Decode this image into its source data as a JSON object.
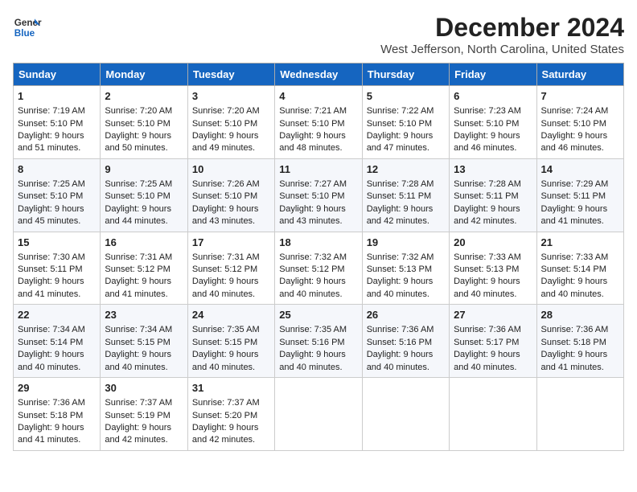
{
  "header": {
    "logo_line1": "General",
    "logo_line2": "Blue",
    "month": "December 2024",
    "location": "West Jefferson, North Carolina, United States"
  },
  "weekdays": [
    "Sunday",
    "Monday",
    "Tuesday",
    "Wednesday",
    "Thursday",
    "Friday",
    "Saturday"
  ],
  "weeks": [
    [
      {
        "day": "1",
        "sunrise": "7:19 AM",
        "sunset": "5:10 PM",
        "daylight": "9 hours and 51 minutes."
      },
      {
        "day": "2",
        "sunrise": "7:20 AM",
        "sunset": "5:10 PM",
        "daylight": "9 hours and 50 minutes."
      },
      {
        "day": "3",
        "sunrise": "7:20 AM",
        "sunset": "5:10 PM",
        "daylight": "9 hours and 49 minutes."
      },
      {
        "day": "4",
        "sunrise": "7:21 AM",
        "sunset": "5:10 PM",
        "daylight": "9 hours and 48 minutes."
      },
      {
        "day": "5",
        "sunrise": "7:22 AM",
        "sunset": "5:10 PM",
        "daylight": "9 hours and 47 minutes."
      },
      {
        "day": "6",
        "sunrise": "7:23 AM",
        "sunset": "5:10 PM",
        "daylight": "9 hours and 46 minutes."
      },
      {
        "day": "7",
        "sunrise": "7:24 AM",
        "sunset": "5:10 PM",
        "daylight": "9 hours and 46 minutes."
      }
    ],
    [
      {
        "day": "8",
        "sunrise": "7:25 AM",
        "sunset": "5:10 PM",
        "daylight": "9 hours and 45 minutes."
      },
      {
        "day": "9",
        "sunrise": "7:25 AM",
        "sunset": "5:10 PM",
        "daylight": "9 hours and 44 minutes."
      },
      {
        "day": "10",
        "sunrise": "7:26 AM",
        "sunset": "5:10 PM",
        "daylight": "9 hours and 43 minutes."
      },
      {
        "day": "11",
        "sunrise": "7:27 AM",
        "sunset": "5:10 PM",
        "daylight": "9 hours and 43 minutes."
      },
      {
        "day": "12",
        "sunrise": "7:28 AM",
        "sunset": "5:11 PM",
        "daylight": "9 hours and 42 minutes."
      },
      {
        "day": "13",
        "sunrise": "7:28 AM",
        "sunset": "5:11 PM",
        "daylight": "9 hours and 42 minutes."
      },
      {
        "day": "14",
        "sunrise": "7:29 AM",
        "sunset": "5:11 PM",
        "daylight": "9 hours and 41 minutes."
      }
    ],
    [
      {
        "day": "15",
        "sunrise": "7:30 AM",
        "sunset": "5:11 PM",
        "daylight": "9 hours and 41 minutes."
      },
      {
        "day": "16",
        "sunrise": "7:31 AM",
        "sunset": "5:12 PM",
        "daylight": "9 hours and 41 minutes."
      },
      {
        "day": "17",
        "sunrise": "7:31 AM",
        "sunset": "5:12 PM",
        "daylight": "9 hours and 40 minutes."
      },
      {
        "day": "18",
        "sunrise": "7:32 AM",
        "sunset": "5:12 PM",
        "daylight": "9 hours and 40 minutes."
      },
      {
        "day": "19",
        "sunrise": "7:32 AM",
        "sunset": "5:13 PM",
        "daylight": "9 hours and 40 minutes."
      },
      {
        "day": "20",
        "sunrise": "7:33 AM",
        "sunset": "5:13 PM",
        "daylight": "9 hours and 40 minutes."
      },
      {
        "day": "21",
        "sunrise": "7:33 AM",
        "sunset": "5:14 PM",
        "daylight": "9 hours and 40 minutes."
      }
    ],
    [
      {
        "day": "22",
        "sunrise": "7:34 AM",
        "sunset": "5:14 PM",
        "daylight": "9 hours and 40 minutes."
      },
      {
        "day": "23",
        "sunrise": "7:34 AM",
        "sunset": "5:15 PM",
        "daylight": "9 hours and 40 minutes."
      },
      {
        "day": "24",
        "sunrise": "7:35 AM",
        "sunset": "5:15 PM",
        "daylight": "9 hours and 40 minutes."
      },
      {
        "day": "25",
        "sunrise": "7:35 AM",
        "sunset": "5:16 PM",
        "daylight": "9 hours and 40 minutes."
      },
      {
        "day": "26",
        "sunrise": "7:36 AM",
        "sunset": "5:16 PM",
        "daylight": "9 hours and 40 minutes."
      },
      {
        "day": "27",
        "sunrise": "7:36 AM",
        "sunset": "5:17 PM",
        "daylight": "9 hours and 40 minutes."
      },
      {
        "day": "28",
        "sunrise": "7:36 AM",
        "sunset": "5:18 PM",
        "daylight": "9 hours and 41 minutes."
      }
    ],
    [
      {
        "day": "29",
        "sunrise": "7:36 AM",
        "sunset": "5:18 PM",
        "daylight": "9 hours and 41 minutes."
      },
      {
        "day": "30",
        "sunrise": "7:37 AM",
        "sunset": "5:19 PM",
        "daylight": "9 hours and 42 minutes."
      },
      {
        "day": "31",
        "sunrise": "7:37 AM",
        "sunset": "5:20 PM",
        "daylight": "9 hours and 42 minutes."
      },
      null,
      null,
      null,
      null
    ]
  ]
}
